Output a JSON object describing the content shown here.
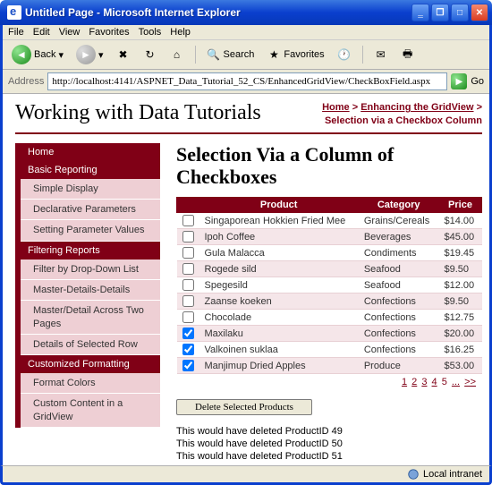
{
  "window": {
    "title": "Untitled Page - Microsoft Internet Explorer"
  },
  "menu": [
    "File",
    "Edit",
    "View",
    "Favorites",
    "Tools",
    "Help"
  ],
  "toolbar": {
    "back": "Back",
    "search": "Search",
    "favorites": "Favorites"
  },
  "address": {
    "label": "Address",
    "url": "http://localhost:4141/ASPNET_Data_Tutorial_52_CS/EnhancedGridView/CheckBoxField.aspx",
    "go": "Go"
  },
  "header": {
    "site_title": "Working with Data Tutorials",
    "crumb_home": "Home",
    "crumb_sep": " > ",
    "crumb_section": "Enhancing the GridView",
    "crumb_tail": " >",
    "crumb_current": "Selection via a Checkbox Column"
  },
  "sidebar": {
    "groups": [
      {
        "type": "group",
        "label": "Home"
      },
      {
        "type": "group",
        "label": "Basic Reporting"
      },
      {
        "type": "item",
        "label": "Simple Display"
      },
      {
        "type": "item",
        "label": "Declarative Parameters"
      },
      {
        "type": "item",
        "label": "Setting Parameter Values"
      },
      {
        "type": "group",
        "label": "Filtering Reports"
      },
      {
        "type": "item",
        "label": "Filter by Drop-Down List"
      },
      {
        "type": "item",
        "label": "Master-Details-Details"
      },
      {
        "type": "item",
        "label": "Master/Detail Across Two Pages"
      },
      {
        "type": "item",
        "label": "Details of Selected Row"
      },
      {
        "type": "group",
        "label": "Customized Formatting"
      },
      {
        "type": "item",
        "label": "Format Colors"
      },
      {
        "type": "item",
        "label": "Custom Content in a GridView"
      }
    ]
  },
  "main": {
    "heading": "Selection Via a Column of Checkboxes",
    "columns": {
      "product": "Product",
      "category": "Category",
      "price": "Price"
    },
    "rows": [
      {
        "checked": false,
        "product": "Singaporean Hokkien Fried Mee",
        "category": "Grains/Cereals",
        "price": "$14.00"
      },
      {
        "checked": false,
        "product": "Ipoh Coffee",
        "category": "Beverages",
        "price": "$45.00"
      },
      {
        "checked": false,
        "product": "Gula Malacca",
        "category": "Condiments",
        "price": "$19.45"
      },
      {
        "checked": false,
        "product": "Rogede sild",
        "category": "Seafood",
        "price": "$9.50"
      },
      {
        "checked": false,
        "product": "Spegesild",
        "category": "Seafood",
        "price": "$12.00"
      },
      {
        "checked": false,
        "product": "Zaanse koeken",
        "category": "Confections",
        "price": "$9.50"
      },
      {
        "checked": false,
        "product": "Chocolade",
        "category": "Confections",
        "price": "$12.75"
      },
      {
        "checked": true,
        "product": "Maxilaku",
        "category": "Confections",
        "price": "$20.00"
      },
      {
        "checked": true,
        "product": "Valkoinen suklaa",
        "category": "Confections",
        "price": "$16.25"
      },
      {
        "checked": true,
        "product": "Manjimup Dried Apples",
        "category": "Produce",
        "price": "$53.00"
      }
    ],
    "pager": {
      "pages": [
        "1",
        "2",
        "3",
        "4",
        "5"
      ],
      "current": "5",
      "more": "...",
      "next": ">>"
    },
    "delete_label": "Delete Selected Products",
    "messages": [
      "This would have deleted ProductID 49",
      "This would have deleted ProductID 50",
      "This would have deleted ProductID 51"
    ]
  },
  "status": {
    "zone": "Local intranet"
  }
}
